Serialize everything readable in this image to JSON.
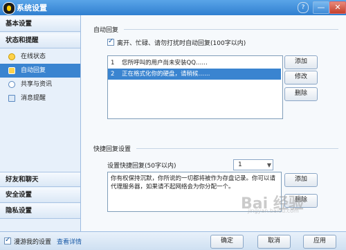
{
  "window": {
    "title": "系统设置",
    "help": "?",
    "minimize": "—",
    "maximize": "□",
    "close": "✕"
  },
  "sidebar": {
    "basic": "基本设置",
    "status": "状态和提醒",
    "items": [
      {
        "label": "在线状态",
        "icon": "online-status-icon"
      },
      {
        "label": "自动回复",
        "icon": "auto-reply-icon"
      },
      {
        "label": "共享与资讯",
        "icon": "share-info-icon"
      },
      {
        "label": "消息提醒",
        "icon": "message-reminder-icon"
      }
    ],
    "friends": "好友和聊天",
    "security": "安全设置",
    "privacy": "隐私设置"
  },
  "auto_reply": {
    "section_title": "自动回复",
    "checkbox_label": "离开、忙碌、请勿打扰时自动回复(100字以内)",
    "list": [
      {
        "num": "1",
        "text": "您所呼叫的用户尚未安装QQ……"
      },
      {
        "num": "2",
        "text": "正在格式化你的硬盘，请稍候……"
      }
    ],
    "buttons": {
      "add": "添加",
      "edit": "修改",
      "delete": "删除"
    }
  },
  "quick_reply": {
    "section_title": "快捷回复设置",
    "setting_label": "设置快捷回复(50字以内)",
    "selected": "1",
    "text": "你有权保持沉默，你所说的一切都将被作为存盘记录。你可以请代理服务器，如果请不起网络会为你分配一个。",
    "buttons": {
      "add": "添加",
      "delete": "删除"
    }
  },
  "bottom": {
    "roam_label": "漫游我的设置",
    "details_link": "查看详情",
    "ok": "确定",
    "cancel": "取消",
    "apply": "应用"
  },
  "watermark": {
    "main": "Bai 经验",
    "sub": "jingyan.baidu.com"
  },
  "colors": {
    "selection": "#3a84d0",
    "titlebar": "#2f7fd0",
    "sidebar_bg": "#e7f0fa"
  }
}
